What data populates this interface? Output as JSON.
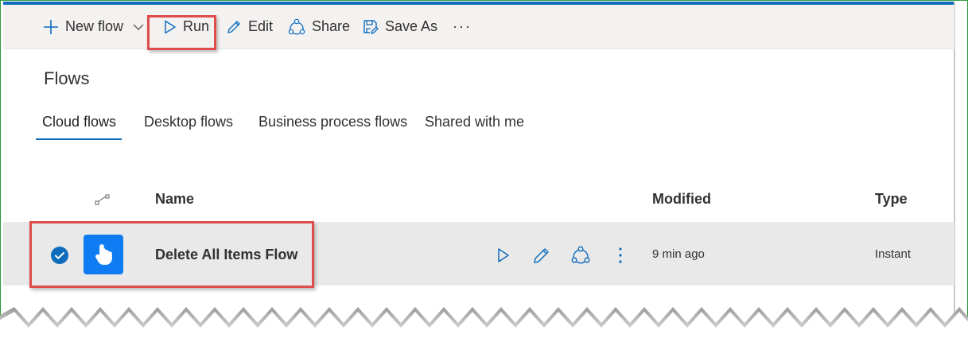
{
  "commandbar": {
    "new_flow": "New flow",
    "run": "Run",
    "edit": "Edit",
    "share": "Share",
    "save_as": "Save As",
    "more": "···"
  },
  "page": {
    "title": "Flows"
  },
  "tabs": [
    {
      "label": "Cloud flows",
      "active": true
    },
    {
      "label": "Desktop flows",
      "active": false
    },
    {
      "label": "Business process flows",
      "active": false
    },
    {
      "label": "Shared with me",
      "active": false
    }
  ],
  "table": {
    "headers": {
      "name": "Name",
      "modified": "Modified",
      "type": "Type"
    },
    "rows": [
      {
        "name": "Delete All Items Flow",
        "modified": "9 min ago",
        "type": "Instant",
        "selected": true
      }
    ]
  },
  "colors": {
    "accent": "#0f6cbd",
    "highlight": "#e04b4b",
    "tile": "#0f7cf4"
  }
}
